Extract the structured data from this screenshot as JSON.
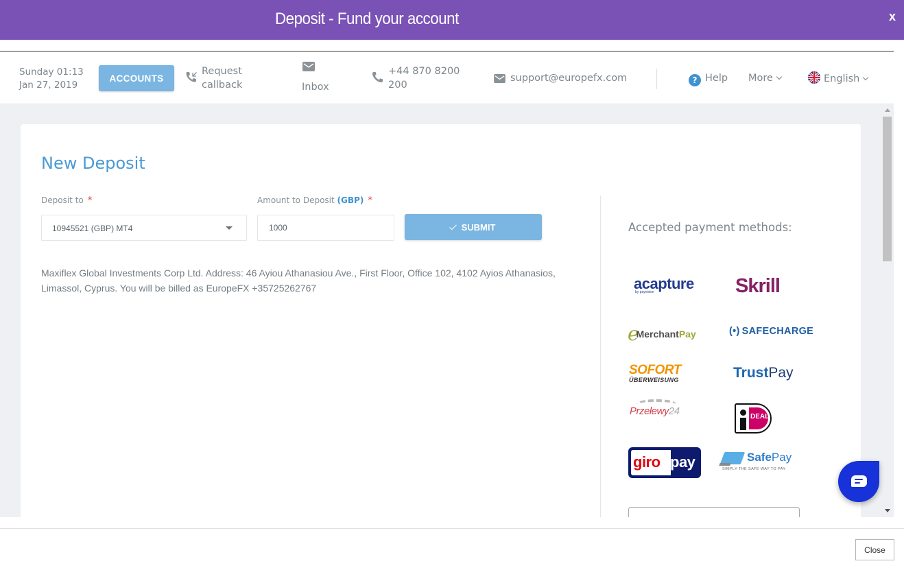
{
  "modal": {
    "title": "Deposit - Fund your account",
    "close_x": "x",
    "close_button": "Close"
  },
  "nav": {
    "date_line1": "Sunday 01:13",
    "date_line2": "Jan 27, 2019",
    "accounts_button": "ACCOUNTS",
    "callback_line1": "Request",
    "callback_line2": "callback",
    "inbox": "Inbox",
    "phone_line1": "+44 870 8200",
    "phone_line2": "200",
    "email": "support@europefx.com",
    "help": "Help",
    "more": "More",
    "language": "English"
  },
  "form": {
    "title": "New Deposit",
    "deposit_to_label": "Deposit to",
    "deposit_to_value": "10945521 (GBP) MT4",
    "amount_label": "Amount to Deposit",
    "amount_currency": "(GBP)",
    "required_mark": "*",
    "amount_value": "1000",
    "submit_button": "SUBMIT",
    "address": "Maxiflex Global Investments Corp Ltd. Address: 46 Ayiou Athanasiou Ave., First Floor, Office 102, 4102 Ayios Athanasios, Limassol, Cyprus. You will be billed as EuropeFX +35725262767"
  },
  "payment_methods": {
    "title": "Accepted payment methods:",
    "logos": {
      "acapture": "acapture",
      "acapture_sub": "by payvision",
      "skrill": "Skrill",
      "emerchantpay_e": "e",
      "emerchantpay_merchant": "Merchant",
      "emerchantpay_pay": "Pay",
      "safecharge_bracket": "(•)",
      "safecharge": "SAFECHARGE",
      "sofort_top": "SOFORT",
      "sofort_bottom": "ÜBERWEISUNG",
      "trustpay_bold": "Trust",
      "trustpay_rest": "Pay",
      "przelewy": "Przelewy",
      "przelewy_num": "24",
      "ideal": "DEAL",
      "giro": "giro",
      "giropay_pay": "pay",
      "safepay_bold": "Safe",
      "safepay_rest": "Pay",
      "safepay_tagline": "SIMPLY THE SAFE WAY TO PAY"
    }
  },
  "colors": {
    "titlebar": "#7a52b6",
    "accent_blue": "#7bb5e2",
    "heading_blue": "#4a9ad4",
    "required_red": "#e53935",
    "chat_blue": "#1632d8"
  }
}
